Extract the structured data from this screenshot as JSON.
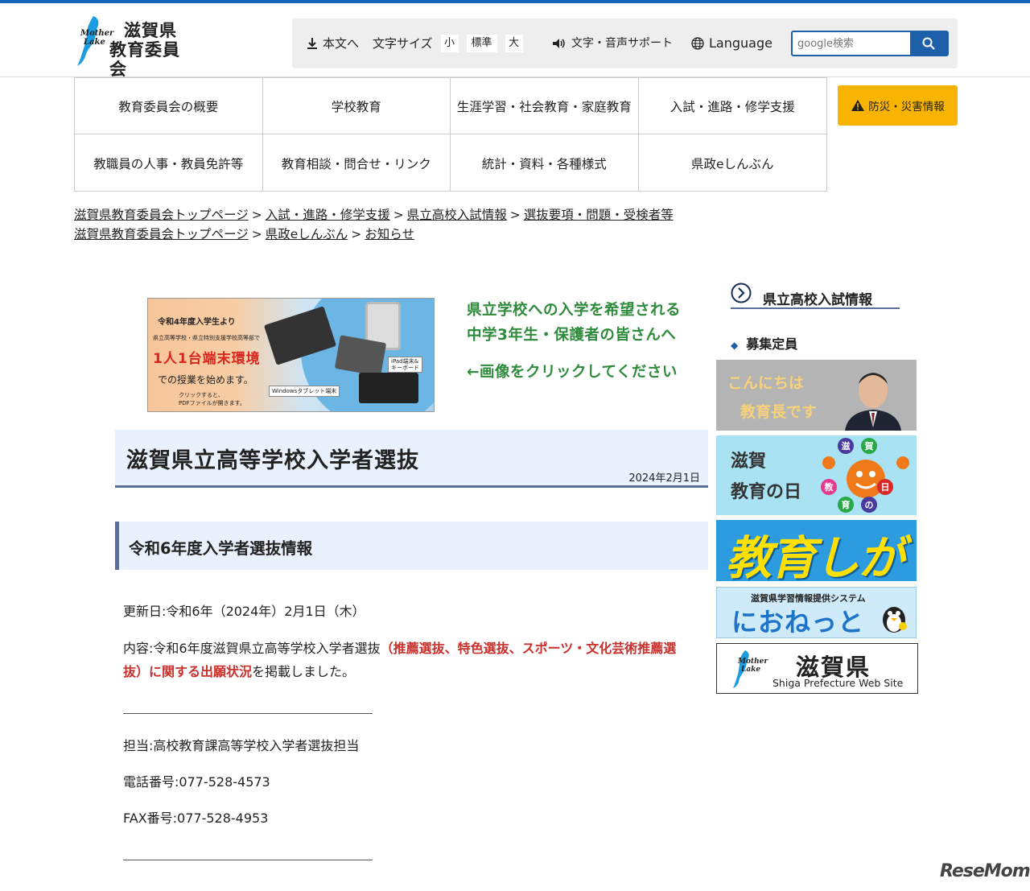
{
  "header": {
    "logo_line1": "滋賀県",
    "logo_line2": "教育委員会",
    "logo_motto_1": "Mother",
    "logo_motto_2": "Lake",
    "skip_label": "本文へ",
    "font_size_label": "文字サイズ",
    "size_small": "小",
    "size_standard": "標準",
    "size_large": "大",
    "support_label": "文字・音声サポート",
    "language_label": "Language",
    "search_placeholder": "google検索"
  },
  "nav": {
    "items": [
      "教育委員会の概要",
      "学校教育",
      "生涯学習・社会教育・家庭教育",
      "入試・進路・修学支援",
      "教職員の人事・教員免許等",
      "教育相談・問合せ・リンク",
      "統計・資料・各種様式",
      "県政eしんぶん"
    ],
    "disaster_label": "防災・災害情報"
  },
  "breadcrumbs": {
    "row1": [
      "滋賀県教育委員会トップページ",
      "入試・進路・修学支援",
      "県立高校入試情報",
      "選抜要項・問題・受検者等"
    ],
    "row2": [
      "滋賀県教育委員会トップページ",
      "県政eしんぶん",
      "お知らせ"
    ],
    "separator": ">"
  },
  "banner": {
    "line1": "令和4年度入学生より",
    "line2": "県立高等学校・県立特別支援学校高等部で",
    "line3": "1人1台端末環境",
    "line4": "での授業を始めます。",
    "line5a": "クリックすると、",
    "line5b": "PDFファイルが開きます。",
    "label_windows": "Windowsタブレット端末",
    "label_ipad_1": "iPad端末&",
    "label_ipad_2": "キーボード"
  },
  "promo": {
    "line1": "県立学校への入学を希望される",
    "line2": "中学3年生・保護者の皆さんへ",
    "line3": "←画像をクリックしてください"
  },
  "article": {
    "title": "滋賀県立高等学校入学者選抜",
    "date": "2024年2月1日",
    "section_heading": "令和6年度入学者選抜情報",
    "updated": "更新日:令和6年（2024年）2月1日（木）",
    "content_prefix": "内容:令和6年度滋賀県立高等学校入学者選抜",
    "content_red_1": "（推薦選抜、特色選抜、スポーツ・文化芸術推薦選",
    "content_red_2": "抜）に関する出願状況",
    "content_suffix": "を掲載しました。",
    "contact": "担当:高校教育課高等学校入学者選抜担当",
    "phone": "電話番号:077-528-4573",
    "fax": "FAX番号:077-528-4953"
  },
  "sidebar": {
    "heading": "県立高校入試情報",
    "item": "募集定員",
    "banner1_line1": "こんにちは",
    "banner1_line2": "教育長です",
    "banner2_line1": "滋賀",
    "banner2_line2": "教育の日",
    "banner2_chars": [
      "滋",
      "賀",
      "教",
      "日",
      "育",
      "の"
    ],
    "banner3": "教育しが",
    "banner4_line1": "滋賀県学習情報提供システム",
    "banner4_line2": "におねっと",
    "banner5_line1": "滋賀県",
    "banner5_line2": "Shiga Prefecture Web Site"
  },
  "watermark": "ReseMom",
  "colors": {
    "accent_blue": "#1d5fa8",
    "promo_green": "#2e8b3c",
    "highlight_red": "#c9302c",
    "disaster_yellow": "#f8b400"
  }
}
